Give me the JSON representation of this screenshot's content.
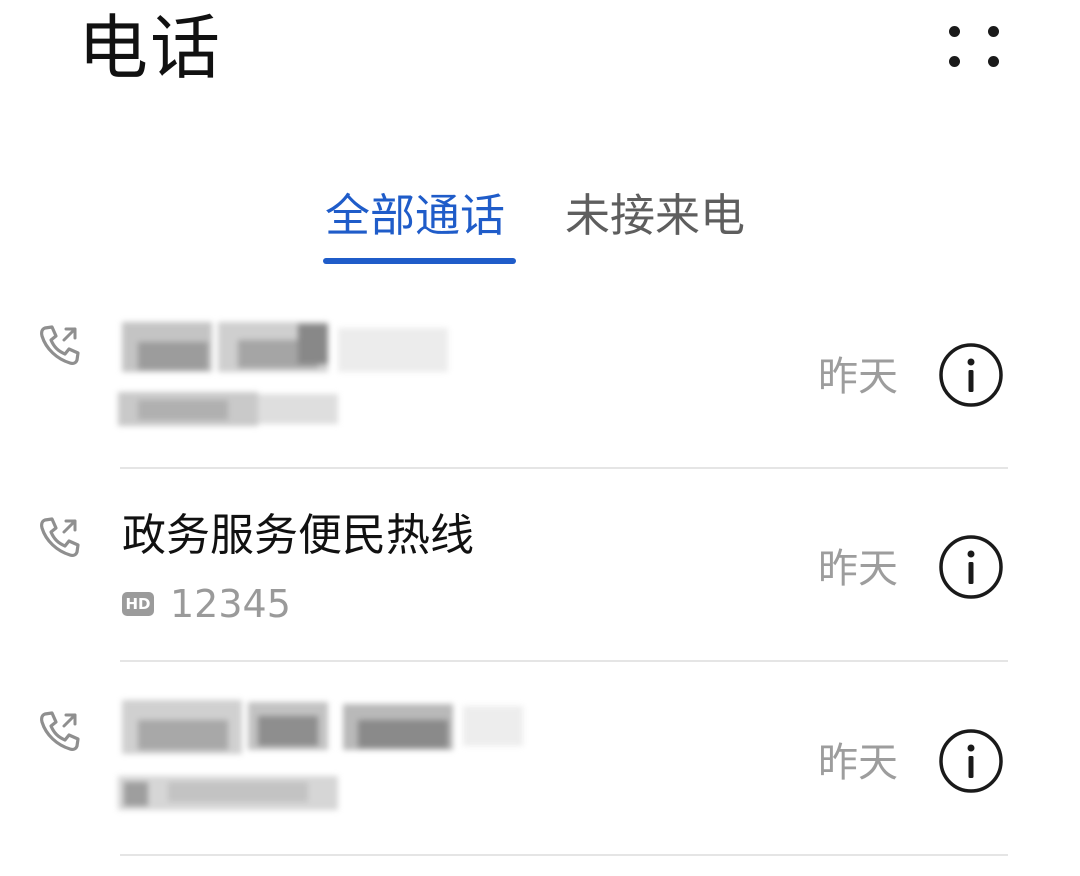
{
  "header": {
    "title": "电话",
    "more_icon": "more-dots-icon"
  },
  "tabs": [
    {
      "label": "全部通话",
      "selected": true
    },
    {
      "label": "未接来电",
      "selected": false
    }
  ],
  "colors": {
    "accent": "#1f5cc9",
    "primary_text": "#111111",
    "secondary_text": "#9d9d9d",
    "divider": "#e5e5e5"
  },
  "calls": [
    {
      "name": "",
      "name_redacted": true,
      "number": "",
      "number_redacted": true,
      "date": "昨天",
      "call_type_icon": "outgoing-call-icon",
      "info_icon": "info-icon"
    },
    {
      "name": "政务服务便民热线",
      "name_redacted": false,
      "hd_badge": "HD",
      "number": "12345",
      "number_redacted": false,
      "date": "昨天",
      "call_type_icon": "outgoing-call-icon",
      "info_icon": "info-icon"
    },
    {
      "name": "",
      "name_redacted": true,
      "number": "",
      "number_redacted": true,
      "date": "昨天",
      "call_type_icon": "outgoing-call-icon",
      "info_icon": "info-icon"
    }
  ]
}
